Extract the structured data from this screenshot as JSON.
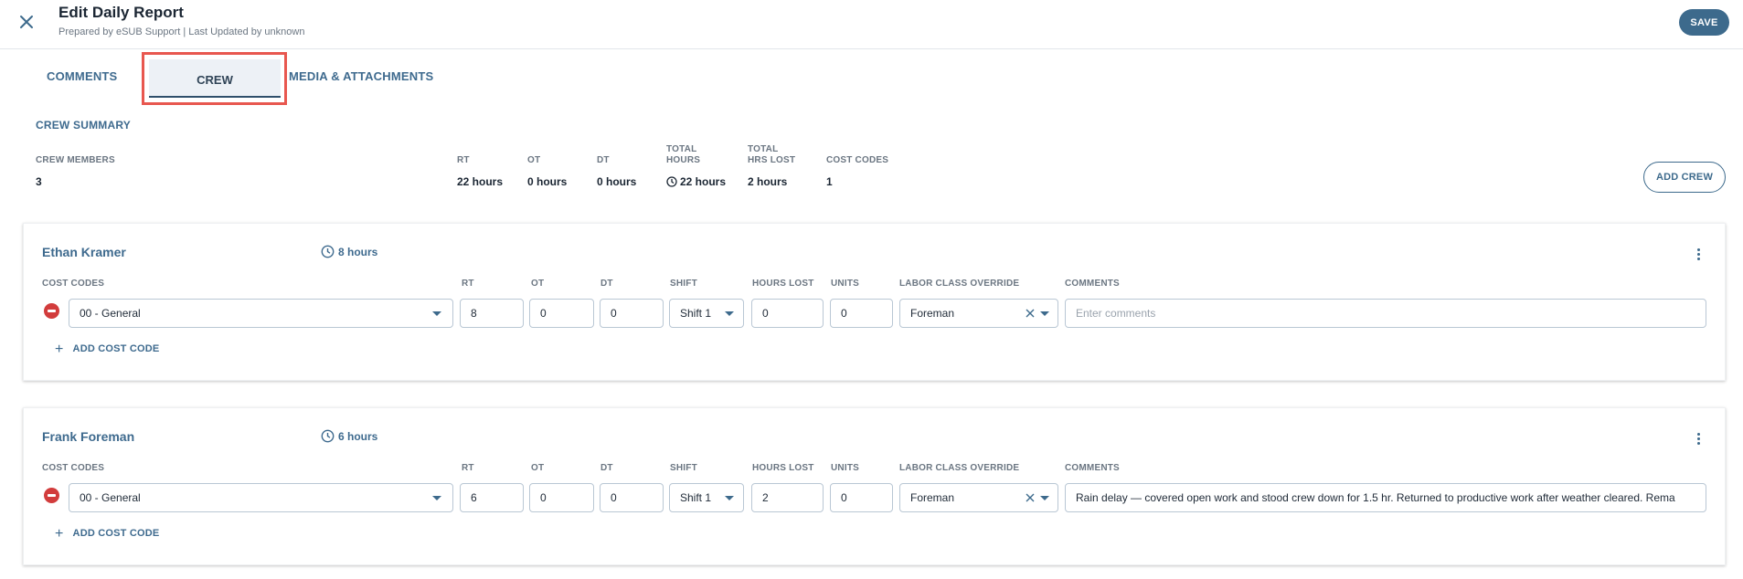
{
  "header": {
    "title": "Edit Daily Report",
    "subtitle": "Prepared by eSUB Support | Last Updated by unknown",
    "save_label": "SAVE"
  },
  "tabs": [
    {
      "label": "COMMENTS",
      "active": false
    },
    {
      "label": "CREW",
      "active": true
    },
    {
      "label": "MEDIA & ATTACHMENTS",
      "active": false
    }
  ],
  "summary": {
    "title": "CREW SUMMARY",
    "crew_members_label": "CREW MEMBERS",
    "crew_members": "3",
    "rt_label": "RT",
    "rt": "22 hours",
    "ot_label": "OT",
    "ot": "0 hours",
    "dt_label": "DT",
    "dt": "0 hours",
    "total_hours_label_1": "TOTAL",
    "total_hours_label_2": "HOURS",
    "total_hours": "22 hours",
    "total_lost_label_1": "TOTAL",
    "total_lost_label_2": "HRS LOST",
    "total_lost": "2 hours",
    "cost_codes_label": "COST CODES",
    "cost_codes": "1",
    "add_crew_label": "ADD CREW"
  },
  "columns": {
    "cost_codes": "COST CODES",
    "rt": "RT",
    "ot": "OT",
    "dt": "DT",
    "shift": "SHIFT",
    "hours_lost": "HOURS LOST",
    "units": "UNITS",
    "labor_class": "LABOR CLASS OVERRIDE",
    "comments": "COMMENTS"
  },
  "crew": [
    {
      "name": "Ethan Kramer",
      "hours": "8 hours",
      "cost_code": "00 - General",
      "rt": "8",
      "ot": "0",
      "dt": "0",
      "shift": "Shift 1",
      "hours_lost": "0",
      "units": "0",
      "labor_class": "Foreman",
      "comments": "",
      "comments_placeholder": "Enter comments",
      "add_cost_code_label": "ADD COST CODE"
    },
    {
      "name": "Frank Foreman",
      "hours": "6 hours",
      "cost_code": "00 - General",
      "rt": "6",
      "ot": "0",
      "dt": "0",
      "shift": "Shift 1",
      "hours_lost": "2",
      "units": "0",
      "labor_class": "Foreman",
      "comments": "Rain delay — covered open work and stood crew down for 1.5 hr. Returned to productive work after weather cleared. Rema",
      "comments_placeholder": "Enter comments",
      "add_cost_code_label": "ADD COST CODE"
    }
  ],
  "colors": {
    "accent": "#3d6a8c",
    "highlight_border": "#e8574f",
    "remove": "#d23c3c"
  }
}
